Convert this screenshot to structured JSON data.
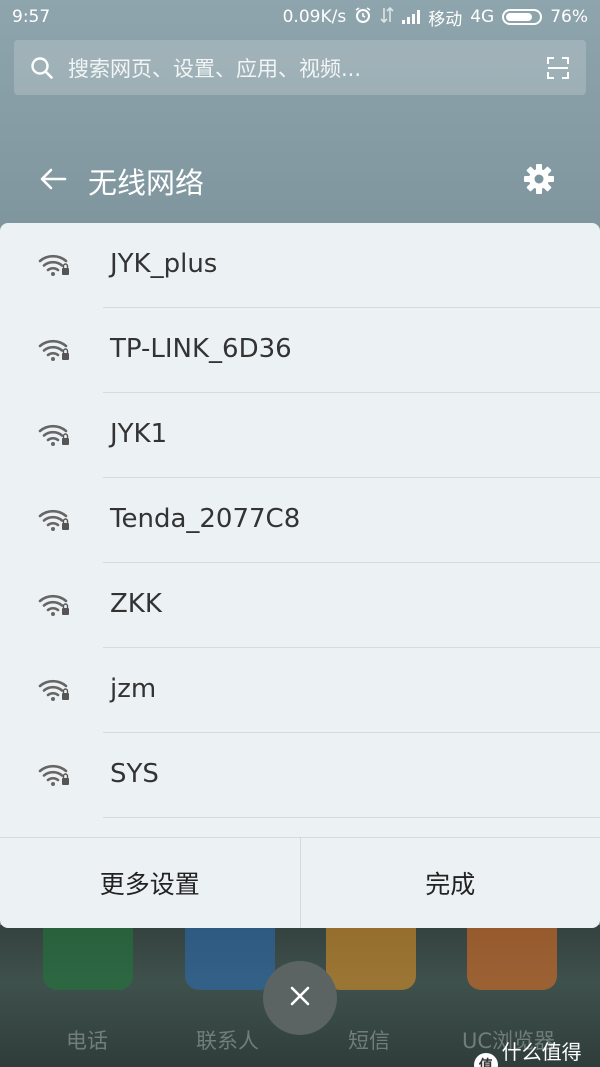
{
  "status_bar": {
    "time": "9:57",
    "net_speed": "0.09K/s",
    "carrier": "移动",
    "network_type": "4G",
    "battery": "76%"
  },
  "search": {
    "placeholder": "搜索网页、设置、应用、视频..."
  },
  "header": {
    "title": "无线网络"
  },
  "networks": [
    {
      "name": "JYK_plus",
      "locked": true
    },
    {
      "name": "TP-LINK_6D36",
      "locked": true
    },
    {
      "name": "JYK1",
      "locked": true
    },
    {
      "name": "Tenda_2077C8",
      "locked": true
    },
    {
      "name": "ZKK",
      "locked": true
    },
    {
      "name": "jzm",
      "locked": true
    },
    {
      "name": "SYS",
      "locked": true
    }
  ],
  "actions": {
    "more_settings": "更多设置",
    "done": "完成"
  },
  "dock": {
    "apps": [
      {
        "label": "电话",
        "icon": "phone-icon",
        "color": "#1f7a3a"
      },
      {
        "label": "联系人",
        "icon": "contacts-icon",
        "color": "#2a6db6"
      },
      {
        "label": "短信",
        "icon": "sms-icon",
        "color": "#e6941f"
      },
      {
        "label": "UC浏览器",
        "icon": "uc-browser-icon",
        "color": "#e8701f"
      }
    ]
  },
  "watermark": {
    "logo": "值",
    "text": "什么值得买"
  },
  "colors": {
    "sheet_bg": "#ecf2f3",
    "header_bg": "#7b929b",
    "text": "#333333"
  }
}
